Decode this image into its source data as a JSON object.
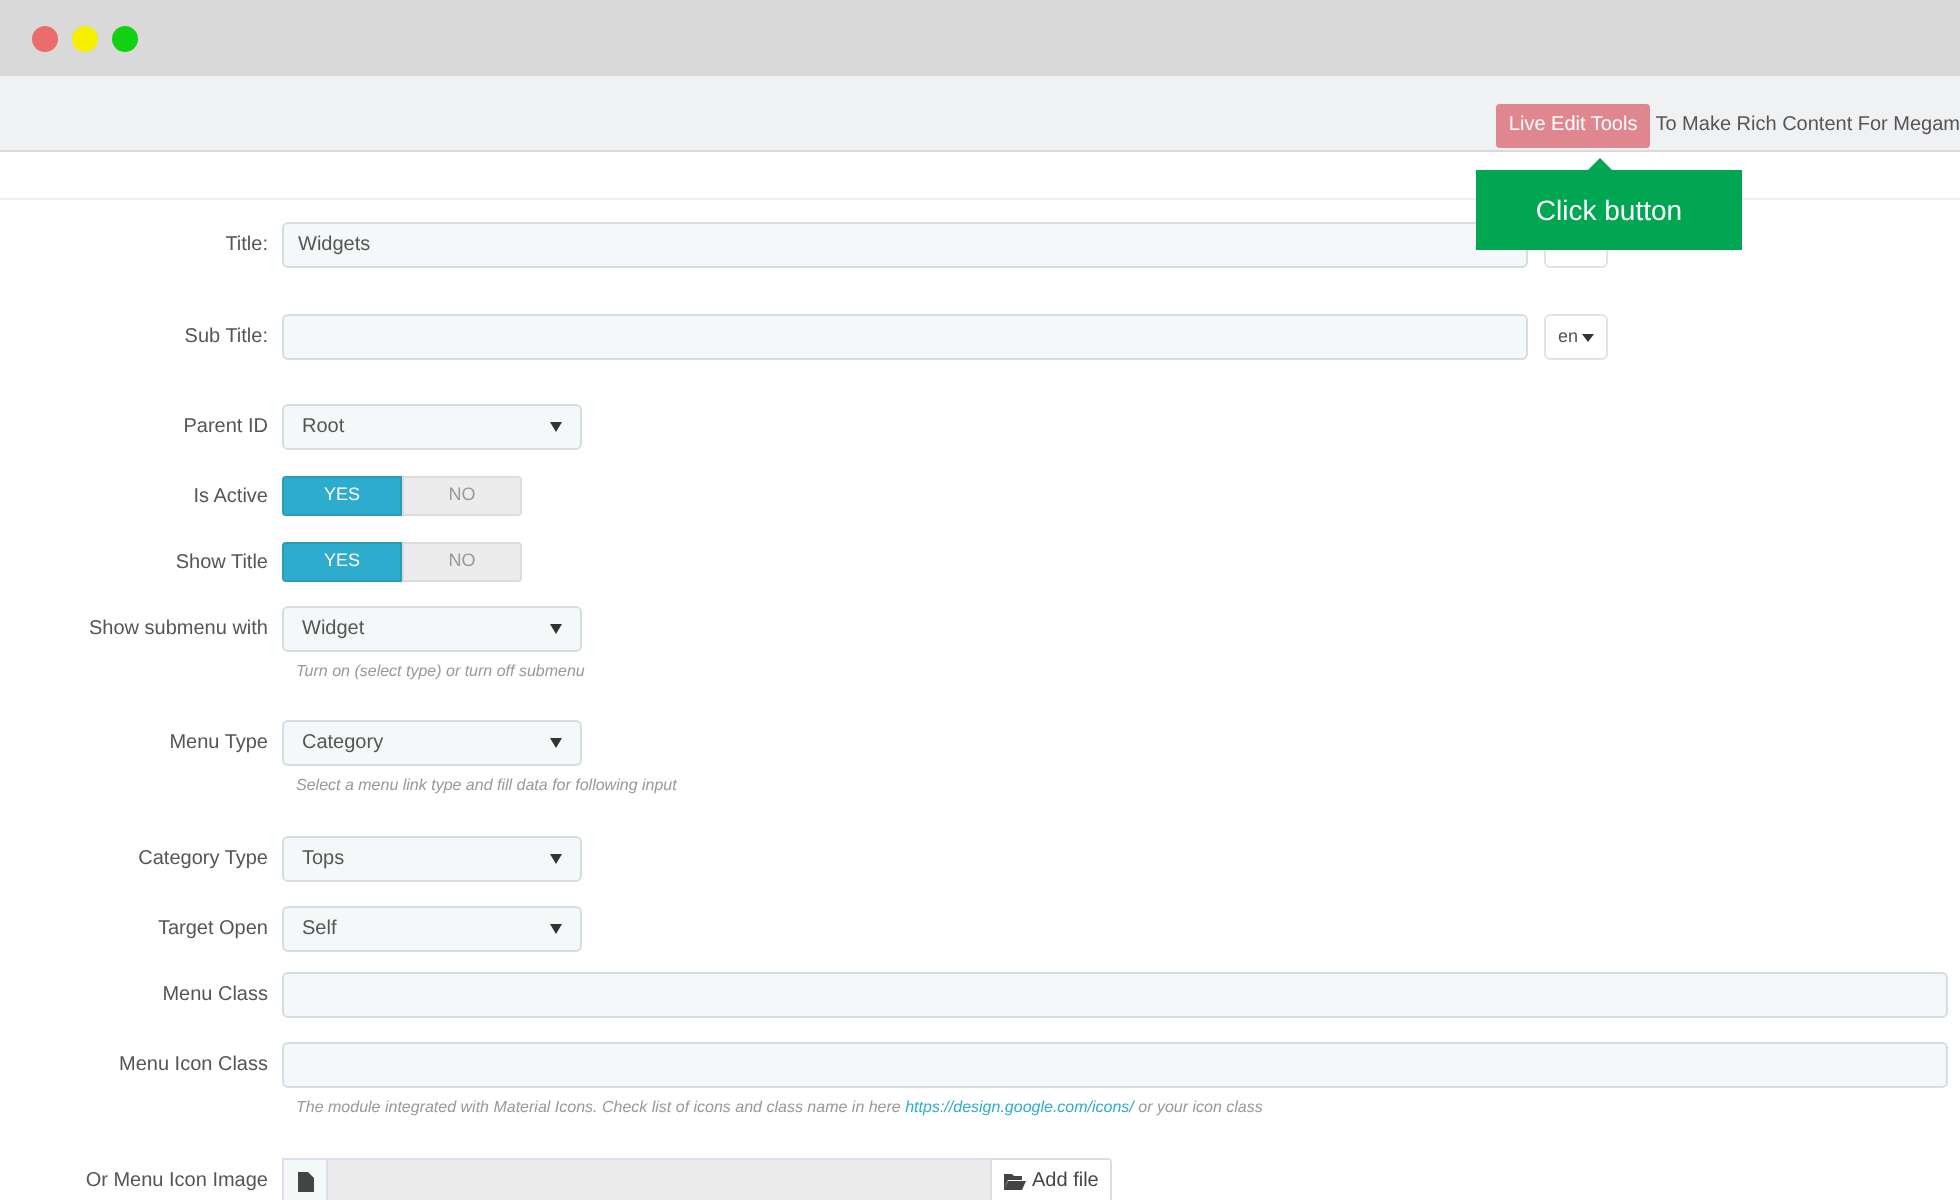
{
  "toolbar": {
    "button": "Live Edit Tools",
    "text": "To Make Rich Content For Megam"
  },
  "tooltip": {
    "text": "Click button"
  },
  "fields": [
    {
      "kind": "text",
      "label": "Title:",
      "value": "Widgets",
      "language_menu": true
    },
    {
      "kind": "text",
      "label": "Sub Title:",
      "language_menu": true,
      "lang": "en"
    },
    {
      "kind": "select",
      "label": "Parent ID",
      "value": "Root"
    },
    {
      "kind": "toggle",
      "label": "Is Active",
      "options": [
        {
          "label": "YES",
          "selected": true
        },
        {
          "label": "NO",
          "selected": false
        }
      ]
    },
    {
      "kind": "toggle",
      "label": "Show Title",
      "options": [
        {
          "label": "YES",
          "selected": true
        },
        {
          "label": "NO",
          "selected": false
        }
      ]
    },
    {
      "kind": "select",
      "label": "Show submenu with",
      "value": "Widget",
      "hint": "Turn on (select type) or turn off submenu"
    },
    {
      "kind": "select",
      "label": "Menu Type",
      "value": "Category",
      "hint": "Select a menu link type and fill data for following input"
    },
    {
      "kind": "select",
      "label": "Target Open",
      "value": "Self",
      "before": {
        "kind": "select",
        "label": "Category Type",
        "value": "Tops"
      }
    },
    {
      "kind": "wide",
      "label": "Menu Class"
    },
    {
      "kind": "wide",
      "label": "Menu Icon Class",
      "hint": "The module integrated with Material Icons. Check list of icons and class name in here",
      "link": "https://design.google.com/icons/",
      "hint_end": "or your icon class"
    },
    {
      "kind": "file",
      "label": "Or Menu Icon Image",
      "button": "Add file"
    }
  ]
}
